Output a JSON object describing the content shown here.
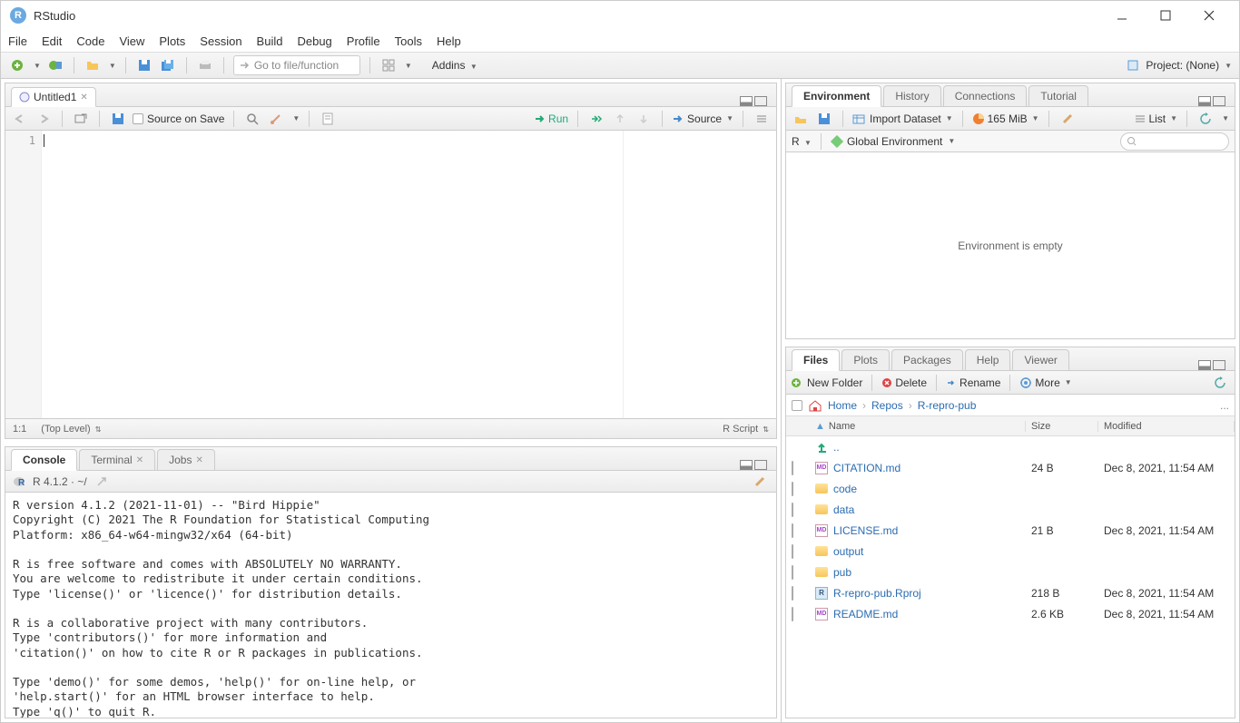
{
  "window": {
    "title": "RStudio"
  },
  "menubar": [
    "File",
    "Edit",
    "Code",
    "View",
    "Plots",
    "Session",
    "Build",
    "Debug",
    "Profile",
    "Tools",
    "Help"
  ],
  "toolbar": {
    "goto_placeholder": "Go to file/function",
    "addins": "Addins",
    "project": "Project: (None)"
  },
  "source": {
    "tab": "Untitled1",
    "source_on_save": "Source on Save",
    "run": "Run",
    "source": "Source",
    "line": "1",
    "pos": "1:1",
    "scope": "(Top Level)",
    "lang": "R Script"
  },
  "console": {
    "tabs": [
      "Console",
      "Terminal",
      "Jobs"
    ],
    "path": "R 4.1.2 · ~/",
    "text": "R version 4.1.2 (2021-11-01) -- \"Bird Hippie\"\nCopyright (C) 2021 The R Foundation for Statistical Computing\nPlatform: x86_64-w64-mingw32/x64 (64-bit)\n\nR is free software and comes with ABSOLUTELY NO WARRANTY.\nYou are welcome to redistribute it under certain conditions.\nType 'license()' or 'licence()' for distribution details.\n\nR is a collaborative project with many contributors.\nType 'contributors()' for more information and\n'citation()' on how to cite R or R packages in publications.\n\nType 'demo()' for some demos, 'help()' for on-line help, or\n'help.start()' for an HTML browser interface to help.\nType 'q()' to quit R.\n"
  },
  "env": {
    "tabs": [
      "Environment",
      "History",
      "Connections",
      "Tutorial"
    ],
    "import": "Import Dataset",
    "mem": "165 MiB",
    "list": "List",
    "r": "R",
    "scope": "Global Environment",
    "empty": "Environment is empty"
  },
  "files": {
    "tabs": [
      "Files",
      "Plots",
      "Packages",
      "Help",
      "Viewer"
    ],
    "newfolder": "New Folder",
    "delete": "Delete",
    "rename": "Rename",
    "more": "More",
    "breadcrumb": [
      "Home",
      "Repos",
      "R-repro-pub"
    ],
    "cols": {
      "name": "Name",
      "size": "Size",
      "modified": "Modified"
    },
    "up": "..",
    "rows": [
      {
        "type": "md",
        "name": "CITATION.md",
        "size": "24 B",
        "mod": "Dec 8, 2021, 11:54 AM"
      },
      {
        "type": "folder",
        "name": "code",
        "size": "",
        "mod": ""
      },
      {
        "type": "folder",
        "name": "data",
        "size": "",
        "mod": ""
      },
      {
        "type": "md",
        "name": "LICENSE.md",
        "size": "21 B",
        "mod": "Dec 8, 2021, 11:54 AM"
      },
      {
        "type": "folder",
        "name": "output",
        "size": "",
        "mod": ""
      },
      {
        "type": "folder",
        "name": "pub",
        "size": "",
        "mod": ""
      },
      {
        "type": "rproj",
        "name": "R-repro-pub.Rproj",
        "size": "218 B",
        "mod": "Dec 8, 2021, 11:54 AM"
      },
      {
        "type": "md",
        "name": "README.md",
        "size": "2.6 KB",
        "mod": "Dec 8, 2021, 11:54 AM"
      }
    ]
  }
}
